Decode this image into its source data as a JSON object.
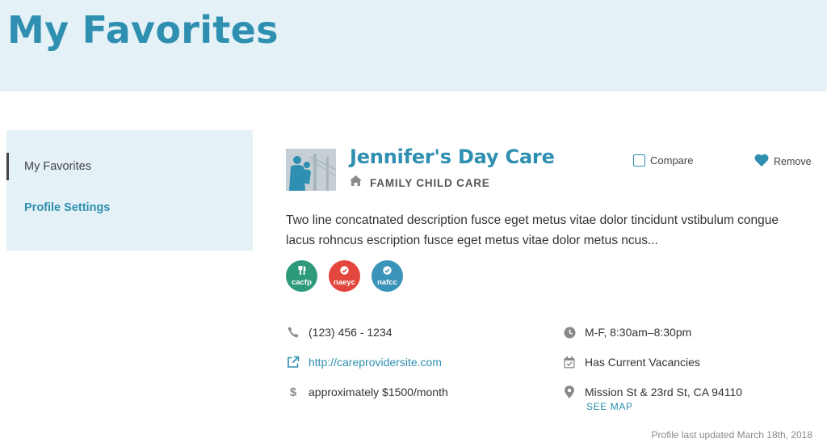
{
  "page": {
    "title": "My Favorites"
  },
  "sidebar": {
    "items": [
      {
        "label": "My Favorites"
      },
      {
        "label": "Profile Settings"
      }
    ]
  },
  "provider": {
    "name": "Jennifer's Day Care",
    "care_type": "FAMILY CHILD CARE",
    "description": "Two line concatnated description fusce eget metus vitae dolor tincidunt vstibulum congue lacus rohncus escription fusce eget metus vitae dolor metus ncus...",
    "compare_label": "Compare",
    "remove_label": "Remove",
    "badges": [
      {
        "label": "cacfp",
        "icon": "fork-knife-icon",
        "color": "#2e9a7c"
      },
      {
        "label": "naeyc",
        "icon": "check-icon",
        "color": "#e2463c"
      },
      {
        "label": "nafcc",
        "icon": "check-icon",
        "color": "#3a93b8"
      }
    ],
    "phone": "(123) 456 - 1234",
    "website": "http://careprovidersite.com",
    "price": "approximately $1500/month",
    "hours": "M-F, 8:30am–8:30pm",
    "vacancies": "Has Current Vacancies",
    "address": "Mission St & 23rd St, CA 94110",
    "see_map": "SEE MAP",
    "updated": "Profile last updated March 18th, 2018"
  },
  "colors": {
    "accent": "#2e8fb0",
    "panel_bg": "#e4f1f6"
  }
}
